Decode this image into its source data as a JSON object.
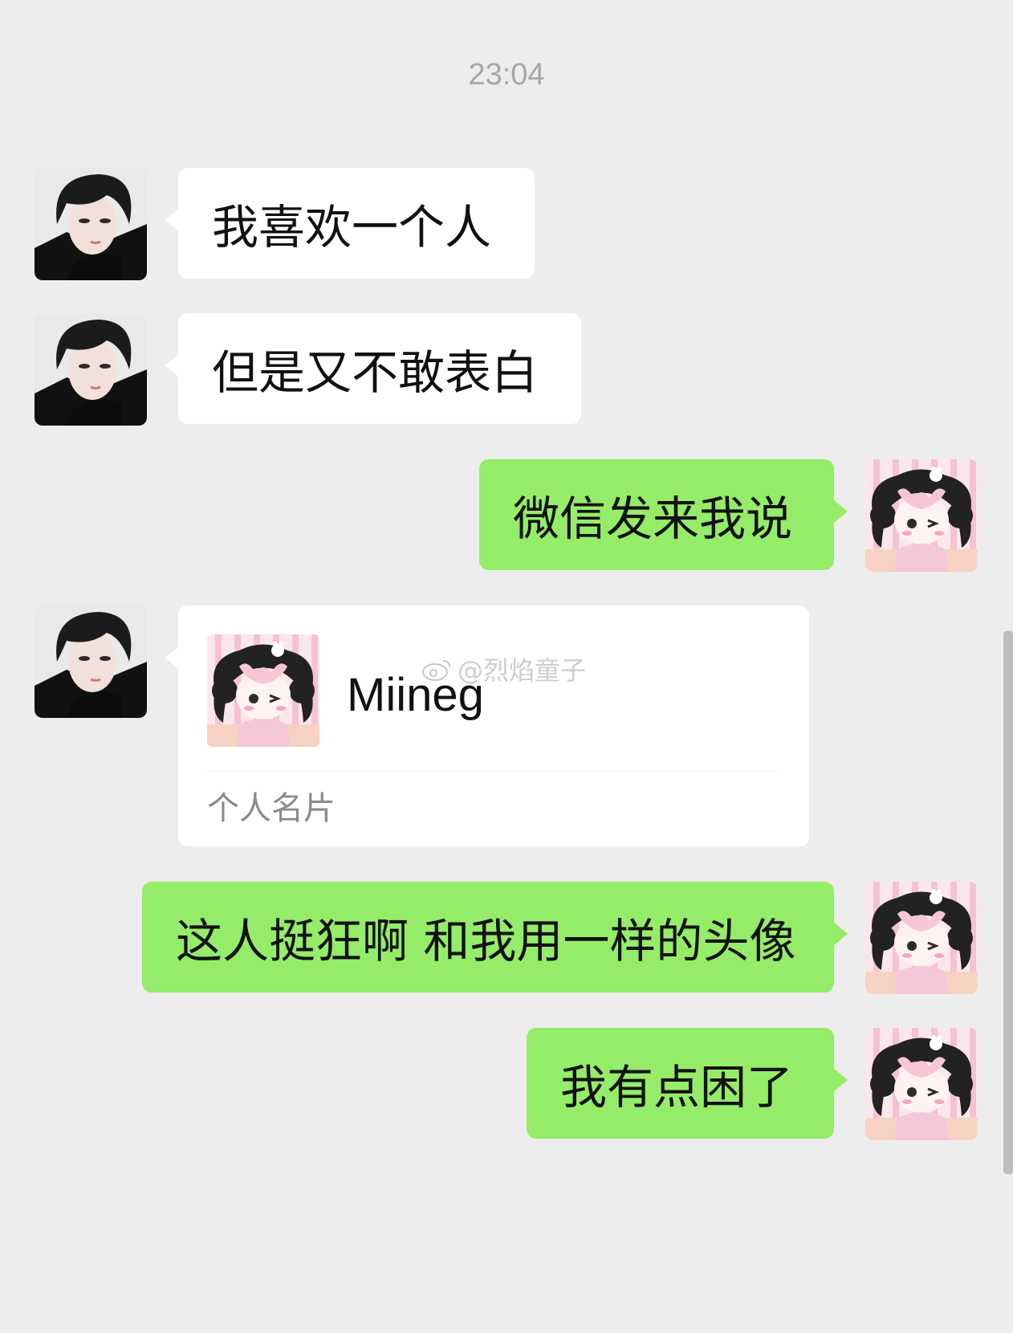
{
  "timestamp": "23:04",
  "messages": [
    {
      "side": "in",
      "text": "我喜欢一个人"
    },
    {
      "side": "in",
      "text": "但是又不敢表白"
    },
    {
      "side": "out",
      "text": "微信发来我说"
    },
    {
      "side": "in",
      "type": "contact_card",
      "name": "Miineg",
      "label": "个人名片"
    },
    {
      "side": "out",
      "text": "这人挺狂啊 和我用一样的头像"
    },
    {
      "side": "out",
      "text": "我有点困了"
    }
  ],
  "watermark": "@烈焰童子",
  "avatars": {
    "other": "male-anime-avatar",
    "me": "pink-chibi-girl-avatar"
  },
  "colors": {
    "background": "#ededed",
    "incoming_bubble": "#ffffff",
    "outgoing_bubble": "#95ec69",
    "timestamp": "#a7a7a7"
  }
}
